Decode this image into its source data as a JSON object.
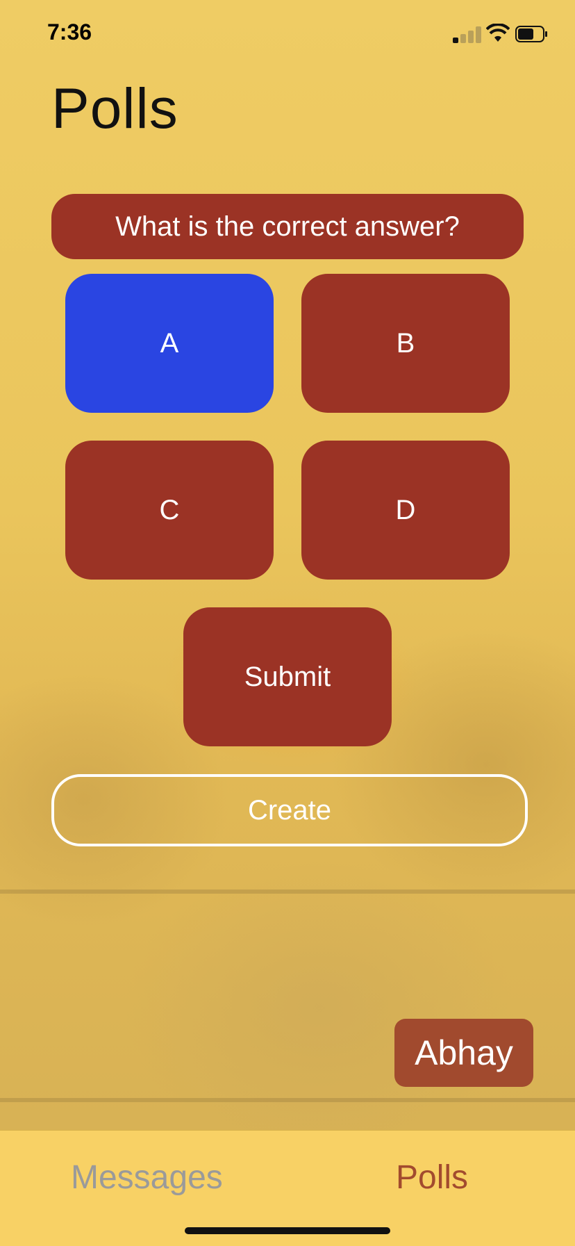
{
  "status": {
    "time": "7:36"
  },
  "header": {
    "title": "Polls"
  },
  "poll": {
    "question": "What is the correct answer?",
    "options": [
      "A",
      "B",
      "C",
      "D"
    ],
    "selected_option": "A",
    "submit_label": "Submit"
  },
  "actions": {
    "create_label": "Create"
  },
  "user": {
    "name": "Abhay"
  },
  "tabs": [
    {
      "label": "Messages",
      "active": false
    },
    {
      "label": "Polls",
      "active": true
    }
  ],
  "colors": {
    "background": "#e9c45a",
    "option": "#9b3325",
    "selected": "#2a45e2",
    "user_badge": "#a14a2e",
    "tab_active": "#a24b2e",
    "tab_inactive": "#9a9a9a"
  },
  "icons": [
    "signal-icon",
    "wifi-icon",
    "battery-icon"
  ]
}
